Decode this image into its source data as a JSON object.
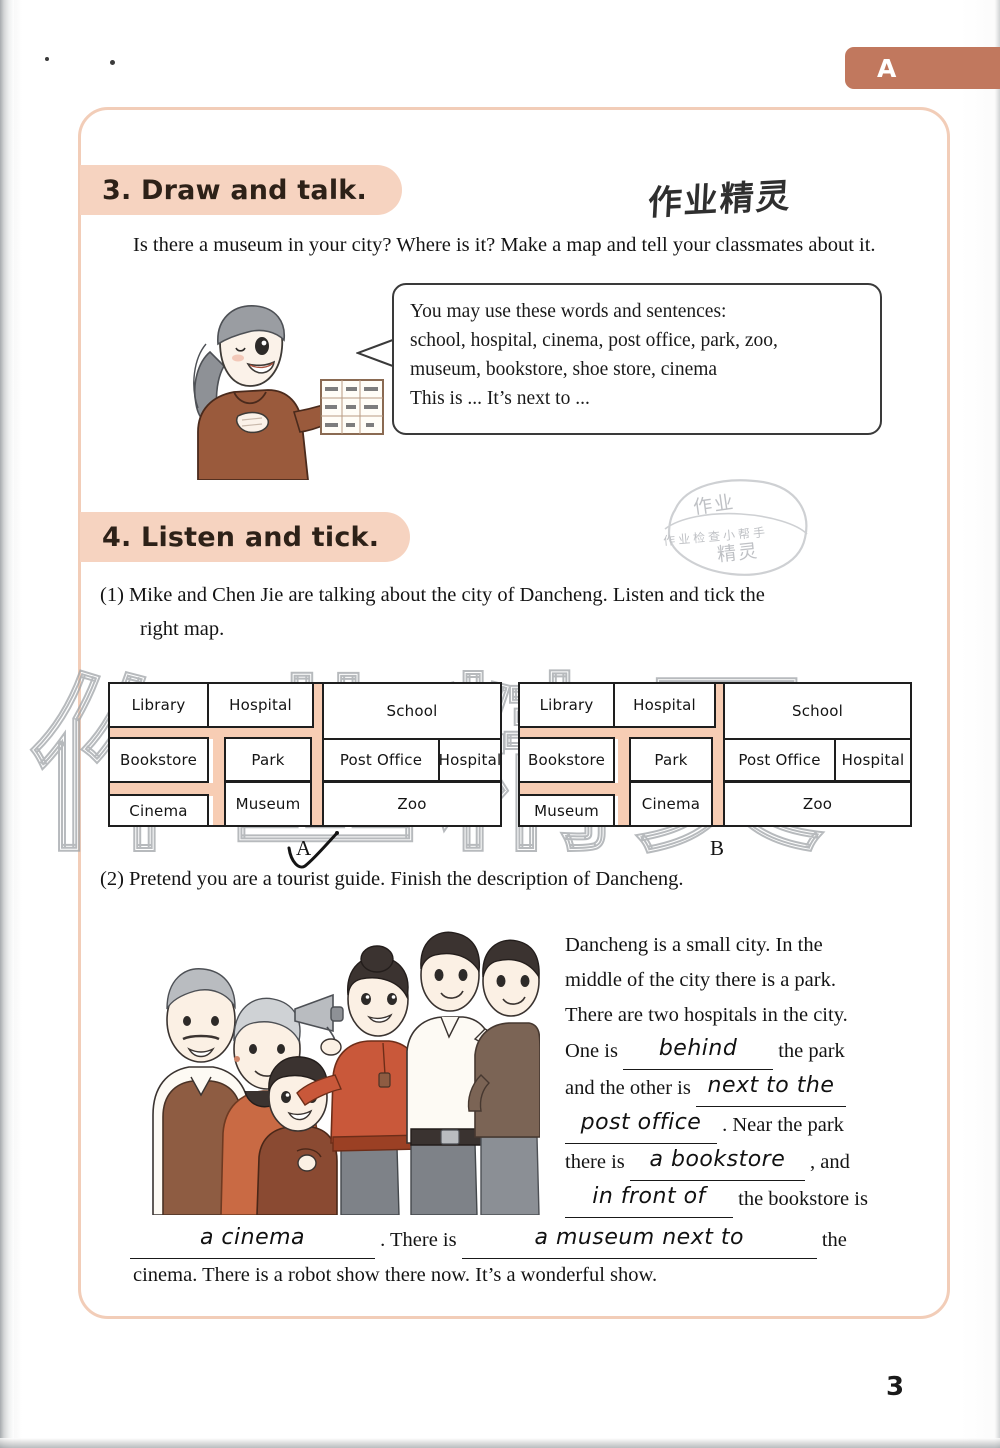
{
  "unit_tab": {
    "label": "A"
  },
  "page_number": "3",
  "watermarks": {
    "handwritten_top": "作业精灵",
    "stamp_top": "作业",
    "stamp_middle": "作业检查小帮手",
    "stamp_bottom": "精灵",
    "big_outline": "作业精灵"
  },
  "task3": {
    "heading": "3. Draw and talk.",
    "prompt": "Is there a museum in your city? Where is it? Make a map and tell your classmates about it.",
    "bubble": [
      "You may use these words and sentences:",
      "school, hospital, cinema, post office, park, zoo,",
      "museum, bookstore, shoe store, cinema",
      "This is ...  It’s next to ..."
    ]
  },
  "task4": {
    "heading": "4. Listen and tick.",
    "q1_text": "(1) Mike and Chen Jie are talking about the city of Dancheng. Listen and tick the",
    "q1_text_line2": "right map.",
    "q2_text": "(2) Pretend you are a tourist guide. Finish the description of Dancheng.",
    "maps": [
      {
        "label": "A",
        "ticked": true,
        "cells": [
          "Library",
          "Hospital",
          "School",
          "Bookstore",
          "Park",
          "Post Office",
          "Hospital",
          "Cinema",
          "Museum",
          "Zoo"
        ]
      },
      {
        "label": "B",
        "ticked": false,
        "cells": [
          "Library",
          "Hospital",
          "School",
          "Bookstore",
          "Park",
          "Post Office",
          "Hospital",
          "Museum",
          "Cinema",
          "Zoo"
        ]
      }
    ],
    "description": {
      "line1": "Dancheng is a small city. In the",
      "line2": "middle of the city there is a park.",
      "line3": "There are two hospitals in the city.",
      "line4_pre": "One is",
      "answer1": "behind",
      "line4_post": "the park",
      "line5_pre": "and the other is",
      "answer2": "next to the",
      "answer3": "post office",
      "line6_post": ". Near the park",
      "line7_pre": "there is",
      "answer4": "a bookstore",
      "line7_post": ", and",
      "answer5": "in front of",
      "line8_post": "the bookstore is",
      "answer6": "a cinema",
      "tail_mid": ". There is",
      "answer7": "a museum next to",
      "tail_end": "the",
      "last_line": "cinema. There is a robot show there now. It’s a wonderful show."
    }
  },
  "colors": {
    "accent_pill": "#f6d3c0",
    "accent_tab": "#c1785e",
    "frame_border": "#f2cdb8",
    "road": "#f7cdb4"
  }
}
